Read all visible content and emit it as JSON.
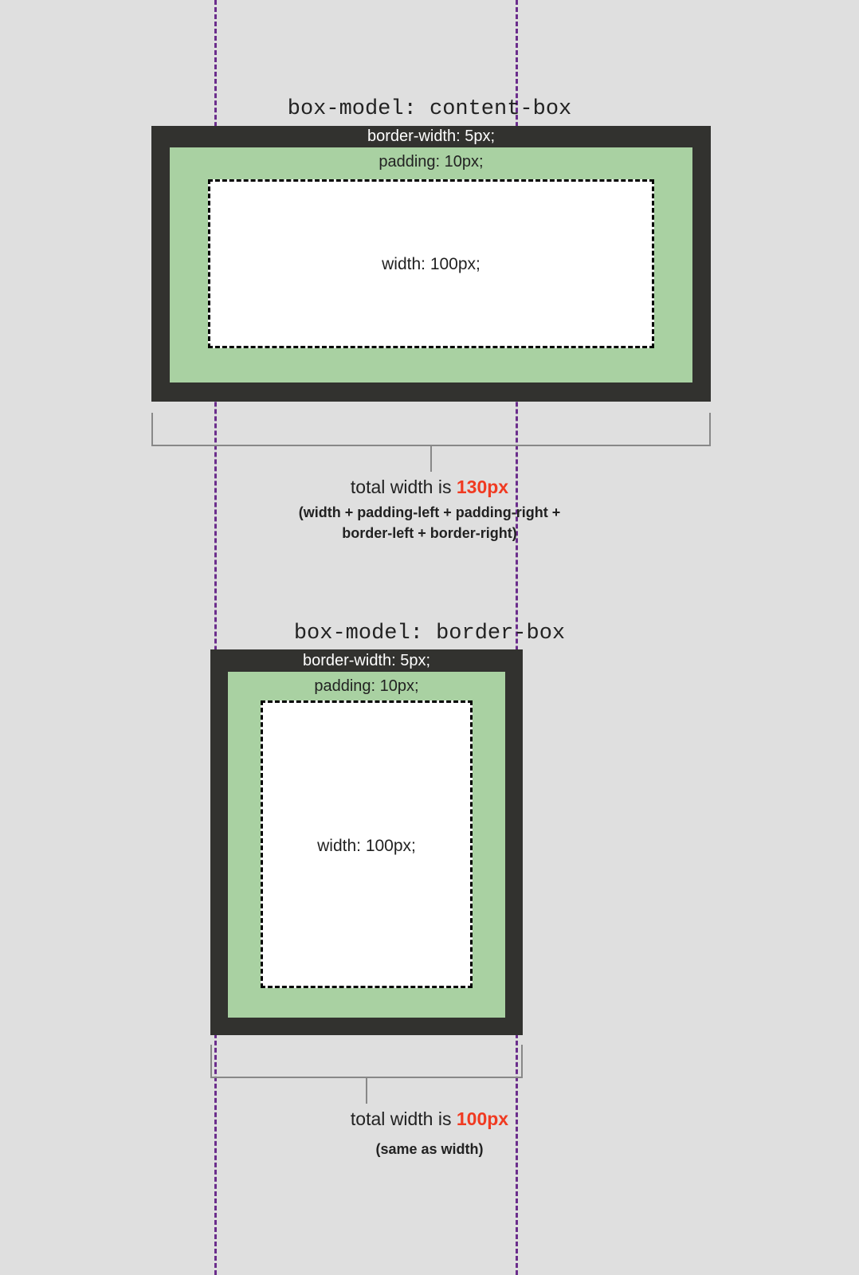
{
  "guides": {
    "color": "#6b2d8c"
  },
  "content_box": {
    "title": "box-model: content-box",
    "border_label": "border-width: 5px;",
    "padding_label": "padding: 10px;",
    "width_label": "width: 100px;",
    "total_label_prefix": "total width is ",
    "total_value": "130px",
    "formula_line1": "(width + padding-left + padding-right +",
    "formula_line2": "border-left + border-right)"
  },
  "border_box": {
    "title": "box-model: border-box",
    "border_label": "border-width: 5px;",
    "padding_label": "padding: 10px;",
    "width_label": "width: 100px;",
    "total_label_prefix": "total width is ",
    "total_value": "100px",
    "formula": "(same as width)"
  },
  "colors": {
    "border": "#32322f",
    "padding": "#a9d1a2",
    "content": "#ffffff",
    "highlight": "#f03a21"
  }
}
